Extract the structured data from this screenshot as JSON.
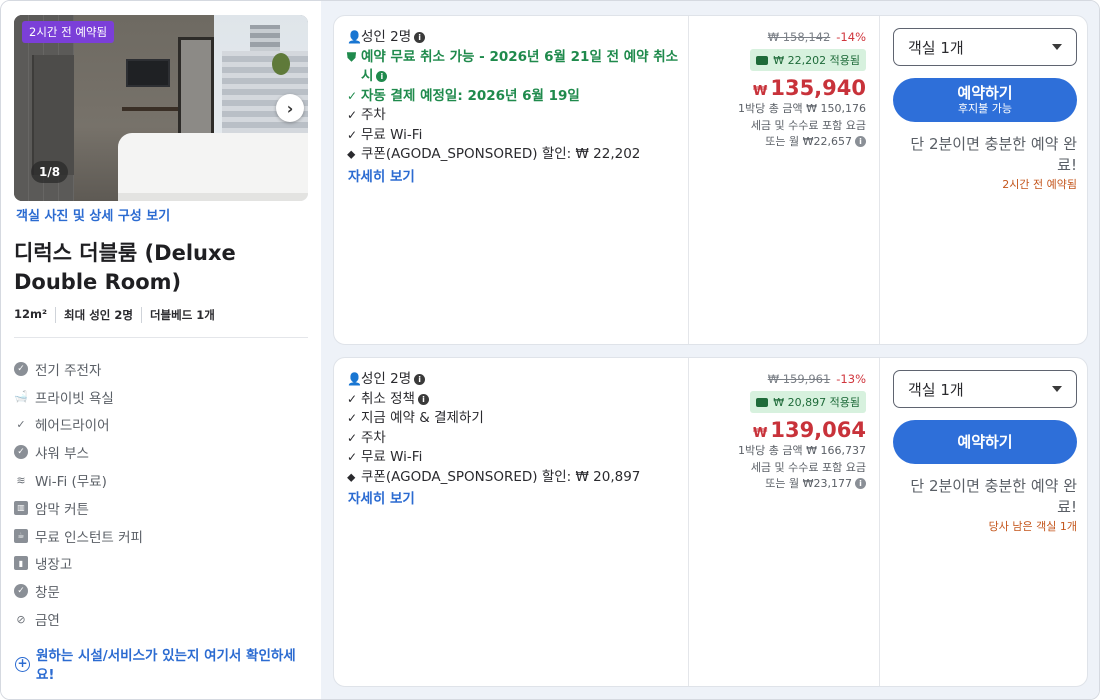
{
  "room": {
    "booked_badge": "2시간 전 예약됨",
    "photo_counter": "1/8",
    "photo_link": "객실 사진 및 상세 구성 보기",
    "title": "디럭스 더블룸 (Deluxe Double Room)",
    "specs": [
      "12m²",
      "최대 성인 2명",
      "더블베드 1개"
    ],
    "amenities": [
      {
        "icon": "check-badge-icon",
        "label": "전기 주전자"
      },
      {
        "icon": "bathtub-icon",
        "label": "프라이빗 욕실"
      },
      {
        "icon": "check-icon",
        "label": "헤어드라이어"
      },
      {
        "icon": "check-badge-icon",
        "label": "샤워 부스"
      },
      {
        "icon": "wifi-icon",
        "label": "Wi-Fi (무료)"
      },
      {
        "icon": "curtain-icon",
        "label": "암막 커튼"
      },
      {
        "icon": "coffee-icon",
        "label": "무료 인스턴트 커피"
      },
      {
        "icon": "fridge-icon",
        "label": "냉장고"
      },
      {
        "icon": "check-badge-icon",
        "label": "창문"
      },
      {
        "icon": "no-smoking-icon",
        "label": "금연"
      }
    ],
    "help_link": "원하는 시설/서비스가 있는지 여기서 확인하세요!"
  },
  "offers": [
    {
      "features": [
        {
          "icon": "person-icon",
          "text": "성인 2명",
          "info": true,
          "green": false
        },
        {
          "icon": "shield-check-icon",
          "text": "예약 무료 취소 가능 - 2026년 6월 21일 전 예약 취소 시",
          "info": true,
          "green": true
        },
        {
          "icon": "check-icon",
          "text": "자동 결제 예정일: 2026년 6월 19일",
          "info": false,
          "green": true
        },
        {
          "icon": "check-icon",
          "text": "주차",
          "info": false,
          "green": false
        },
        {
          "icon": "check-icon",
          "text": "무료 Wi-Fi",
          "info": false,
          "green": false
        },
        {
          "icon": "tag-icon",
          "text": "쿠폰(AGODA_SPONSORED) 할인: ₩ 22,202",
          "info": false,
          "green": false
        }
      ],
      "more_link": "자세히 보기",
      "original_price": "₩ 158,142",
      "discount": "-14%",
      "coupon_applied": "₩ 22,202 적용됨",
      "currency": "₩",
      "price": "135,940",
      "note_total": "1박당 총 금액 ₩ 150,176",
      "note_tax": "세금 및 수수료 포함 요금",
      "note_monthly": "또는 월 ₩22,657",
      "select_value": "객실 1개",
      "book_label": "예약하기",
      "book_sub": "후지불 가능",
      "urgency": "단 2분이면 충분한 예약 완료!",
      "urgency_sub": "2시간 전 예약됨"
    },
    {
      "features": [
        {
          "icon": "person-icon",
          "text": "성인 2명",
          "info": true,
          "green": false
        },
        {
          "icon": "check-icon",
          "text": "취소 정책",
          "info": true,
          "green": false
        },
        {
          "icon": "check-icon",
          "text": "지금 예약 & 결제하기",
          "info": false,
          "green": false
        },
        {
          "icon": "check-icon",
          "text": "주차",
          "info": false,
          "green": false
        },
        {
          "icon": "check-icon",
          "text": "무료 Wi-Fi",
          "info": false,
          "green": false
        },
        {
          "icon": "tag-icon",
          "text": "쿠폰(AGODA_SPONSORED) 할인: ₩ 20,897",
          "info": false,
          "green": false
        }
      ],
      "more_link": "자세히 보기",
      "original_price": "₩ 159,961",
      "discount": "-13%",
      "coupon_applied": "₩ 20,897 적용됨",
      "currency": "₩",
      "price": "139,064",
      "note_total": "1박당 총 금액 ₩ 166,737",
      "note_tax": "세금 및 수수료 포함 요금",
      "note_monthly": "또는 월 ₩23,177",
      "select_value": "객실 1개",
      "book_label": "예약하기",
      "book_sub": "",
      "urgency": "단 2분이면 충분한 예약 완료!",
      "urgency_sub": "당사 남은 객실 1개"
    }
  ],
  "colors": {
    "accent_blue": "#2e6fd9",
    "link_blue": "#2b6bd1",
    "price_red": "#c8323a",
    "green": "#1f8a4c",
    "badge_purple": "#7b3fd8",
    "urgency_orange": "#c4561c"
  }
}
